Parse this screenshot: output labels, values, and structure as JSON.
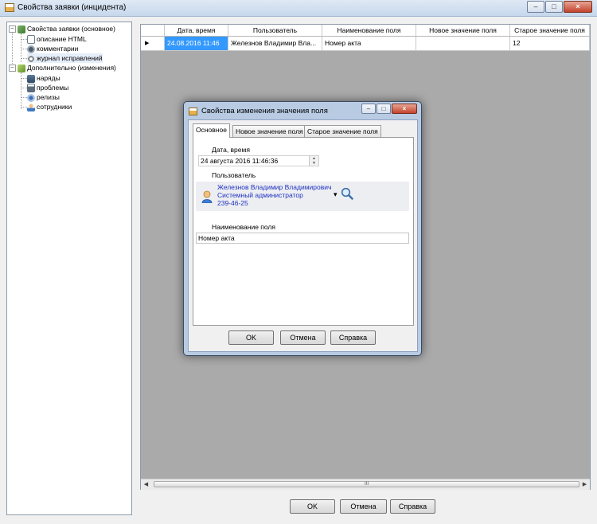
{
  "window": {
    "title": "Свойства заявки (инцидента)",
    "controls": {
      "minimize": "–",
      "maximize": "□",
      "close": "×"
    }
  },
  "tree": {
    "root1": {
      "label": "Свойства заявки (основное)",
      "toggle": "–",
      "children": [
        "описание HTML",
        "комментарии",
        "журнал исправлений"
      ]
    },
    "root2": {
      "label": "Дополнительно (изменения)",
      "toggle": "–",
      "children": [
        "наряды",
        "проблемы",
        "релизы",
        "сотрудники"
      ]
    }
  },
  "grid": {
    "columns": [
      "Дата, время",
      "Пользователь",
      "Наименование поля",
      "Новое значение поля",
      "Старое значение поля"
    ],
    "rows": [
      {
        "indicator": "▶",
        "cells": [
          "24.08.2016 11:46",
          "Железнов Владимир Вла...",
          "Номер акта",
          "",
          "12"
        ]
      }
    ],
    "scroll": {
      "left": "◀",
      "right": "▶",
      "thumb": "III"
    }
  },
  "footer": {
    "ok": "OK",
    "cancel": "Отмена",
    "help": "Справка"
  },
  "dialog": {
    "title": "Свойства изменения значения поля",
    "tabs": [
      "Основное",
      "Новое значение поля",
      "Старое значение поля"
    ],
    "datetime_label": "Дата, время",
    "datetime_value": "24  августа  2016  11:46:36",
    "spin_up": "▲",
    "spin_down": "▼",
    "user_label": "Пользователь",
    "user_name": "Железнов Владимир Владимирович",
    "user_role": "Системный администратор",
    "user_phone": "239-46-25",
    "dropdown": "▾",
    "fieldname_label": "Наименование поля",
    "fieldname_value": "Номер акта",
    "ok": "OK",
    "cancel": "Отмена",
    "help": "Справка"
  },
  "icons": {
    "app": "app-icon",
    "search": "magnifier-icon",
    "user": "user-avatar-icon"
  },
  "colors": {
    "selection": "#3399ff",
    "link": "#2030c0",
    "grid_background": "#aaaaaa"
  }
}
